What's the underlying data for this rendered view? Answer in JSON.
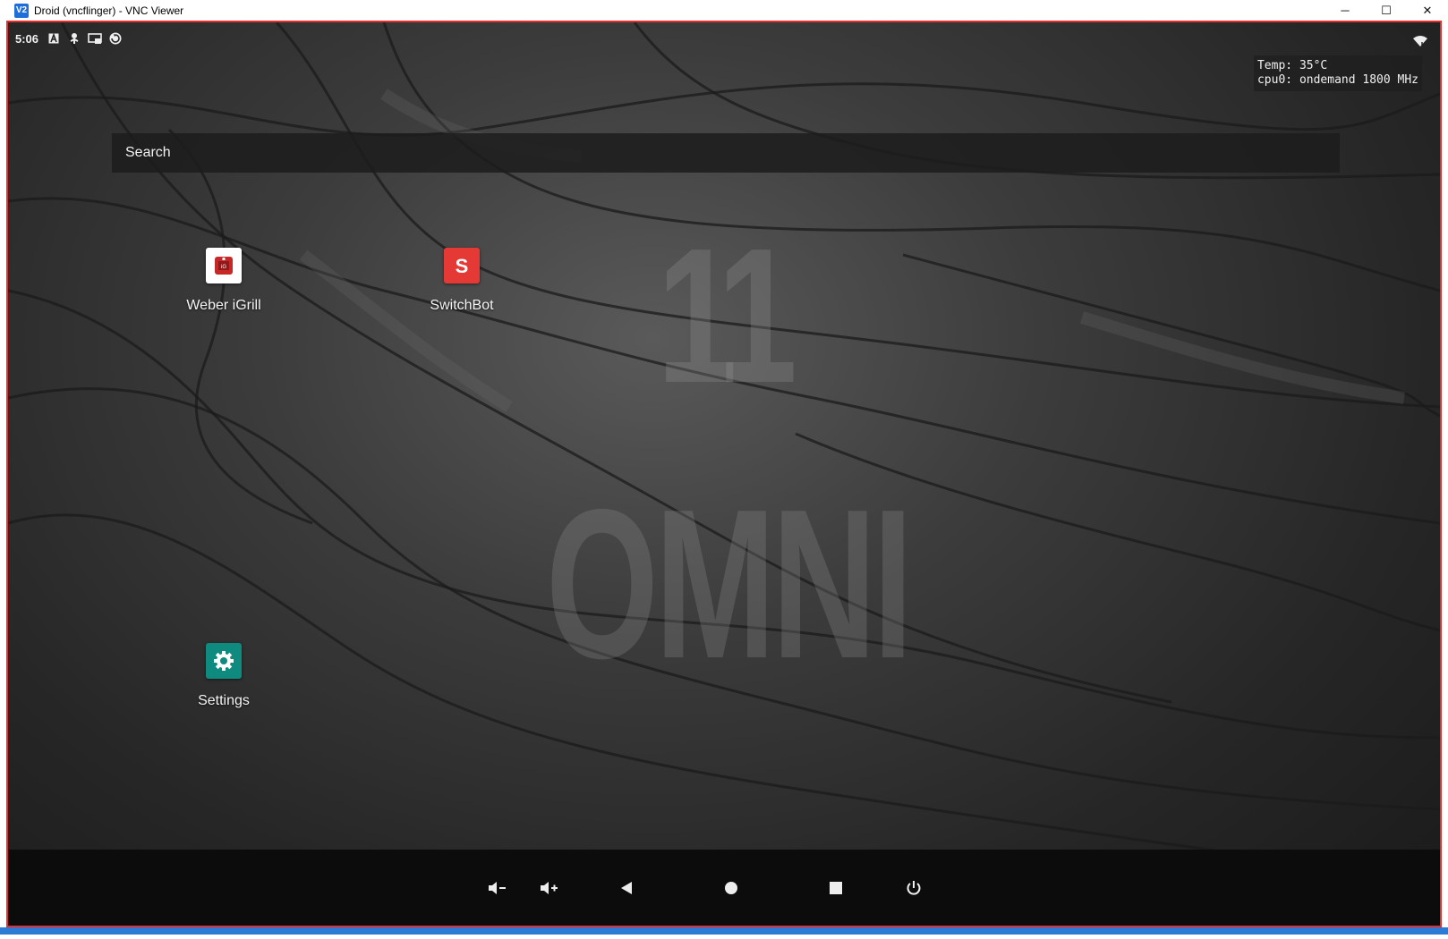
{
  "window": {
    "title": "Droid (vncflinger) - VNC Viewer",
    "icon_text": "V2",
    "controls": {
      "minimize": "─",
      "maximize": "☐",
      "close": "✕"
    }
  },
  "statusbar": {
    "time": "5:06",
    "icons": [
      "notification-a-icon",
      "usb-debug-icon",
      "cast-icon",
      "sync-icon"
    ],
    "wifi": "wifi-icon"
  },
  "overlay": {
    "temp_line": "Temp: 35°C",
    "cpu_line": "cpu0: ondemand 1800 MHz"
  },
  "search": {
    "placeholder": "Search"
  },
  "wallpaper": {
    "version": "11",
    "brand": "OMNI"
  },
  "apps": {
    "weber": {
      "label": "Weber iGrill",
      "color": "#ffffff"
    },
    "switchbot": {
      "label": "SwitchBot",
      "color": "#e53935"
    },
    "settings": {
      "label": "Settings",
      "color": "#0f8a7e"
    }
  },
  "navbar": {
    "buttons": [
      "volume-down-icon",
      "volume-up-icon",
      "back-icon",
      "home-icon",
      "recents-icon",
      "power-icon"
    ]
  },
  "colors": {
    "frame": "#e03030",
    "taskbar": "#2b7bd6",
    "navbar": "#0c0c0c"
  }
}
